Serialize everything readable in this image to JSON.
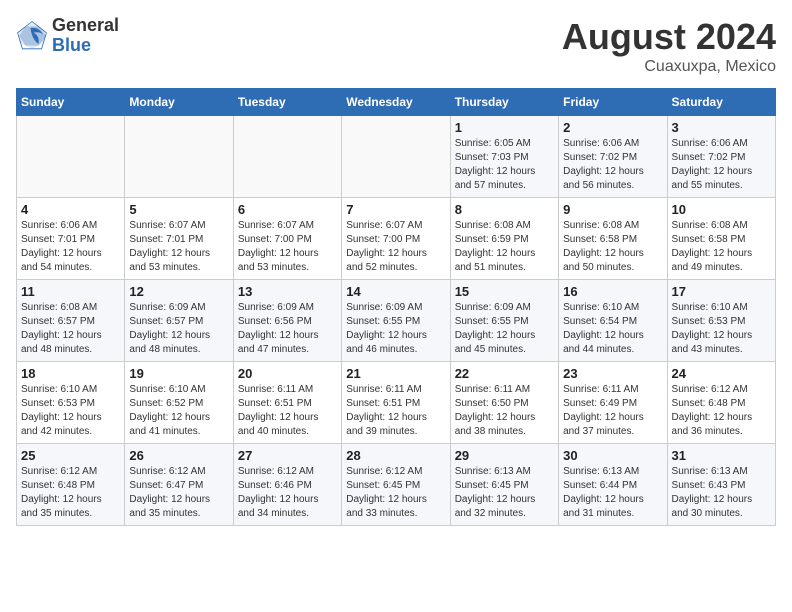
{
  "header": {
    "logo_line1": "General",
    "logo_line2": "Blue",
    "month_year": "August 2024",
    "location": "Cuaxuxpa, Mexico"
  },
  "days_of_week": [
    "Sunday",
    "Monday",
    "Tuesday",
    "Wednesday",
    "Thursday",
    "Friday",
    "Saturday"
  ],
  "weeks": [
    [
      {
        "day": "",
        "info": ""
      },
      {
        "day": "",
        "info": ""
      },
      {
        "day": "",
        "info": ""
      },
      {
        "day": "",
        "info": ""
      },
      {
        "day": "1",
        "info": "Sunrise: 6:05 AM\nSunset: 7:03 PM\nDaylight: 12 hours\nand 57 minutes."
      },
      {
        "day": "2",
        "info": "Sunrise: 6:06 AM\nSunset: 7:02 PM\nDaylight: 12 hours\nand 56 minutes."
      },
      {
        "day": "3",
        "info": "Sunrise: 6:06 AM\nSunset: 7:02 PM\nDaylight: 12 hours\nand 55 minutes."
      }
    ],
    [
      {
        "day": "4",
        "info": "Sunrise: 6:06 AM\nSunset: 7:01 PM\nDaylight: 12 hours\nand 54 minutes."
      },
      {
        "day": "5",
        "info": "Sunrise: 6:07 AM\nSunset: 7:01 PM\nDaylight: 12 hours\nand 53 minutes."
      },
      {
        "day": "6",
        "info": "Sunrise: 6:07 AM\nSunset: 7:00 PM\nDaylight: 12 hours\nand 53 minutes."
      },
      {
        "day": "7",
        "info": "Sunrise: 6:07 AM\nSunset: 7:00 PM\nDaylight: 12 hours\nand 52 minutes."
      },
      {
        "day": "8",
        "info": "Sunrise: 6:08 AM\nSunset: 6:59 PM\nDaylight: 12 hours\nand 51 minutes."
      },
      {
        "day": "9",
        "info": "Sunrise: 6:08 AM\nSunset: 6:58 PM\nDaylight: 12 hours\nand 50 minutes."
      },
      {
        "day": "10",
        "info": "Sunrise: 6:08 AM\nSunset: 6:58 PM\nDaylight: 12 hours\nand 49 minutes."
      }
    ],
    [
      {
        "day": "11",
        "info": "Sunrise: 6:08 AM\nSunset: 6:57 PM\nDaylight: 12 hours\nand 48 minutes."
      },
      {
        "day": "12",
        "info": "Sunrise: 6:09 AM\nSunset: 6:57 PM\nDaylight: 12 hours\nand 48 minutes."
      },
      {
        "day": "13",
        "info": "Sunrise: 6:09 AM\nSunset: 6:56 PM\nDaylight: 12 hours\nand 47 minutes."
      },
      {
        "day": "14",
        "info": "Sunrise: 6:09 AM\nSunset: 6:55 PM\nDaylight: 12 hours\nand 46 minutes."
      },
      {
        "day": "15",
        "info": "Sunrise: 6:09 AM\nSunset: 6:55 PM\nDaylight: 12 hours\nand 45 minutes."
      },
      {
        "day": "16",
        "info": "Sunrise: 6:10 AM\nSunset: 6:54 PM\nDaylight: 12 hours\nand 44 minutes."
      },
      {
        "day": "17",
        "info": "Sunrise: 6:10 AM\nSunset: 6:53 PM\nDaylight: 12 hours\nand 43 minutes."
      }
    ],
    [
      {
        "day": "18",
        "info": "Sunrise: 6:10 AM\nSunset: 6:53 PM\nDaylight: 12 hours\nand 42 minutes."
      },
      {
        "day": "19",
        "info": "Sunrise: 6:10 AM\nSunset: 6:52 PM\nDaylight: 12 hours\nand 41 minutes."
      },
      {
        "day": "20",
        "info": "Sunrise: 6:11 AM\nSunset: 6:51 PM\nDaylight: 12 hours\nand 40 minutes."
      },
      {
        "day": "21",
        "info": "Sunrise: 6:11 AM\nSunset: 6:51 PM\nDaylight: 12 hours\nand 39 minutes."
      },
      {
        "day": "22",
        "info": "Sunrise: 6:11 AM\nSunset: 6:50 PM\nDaylight: 12 hours\nand 38 minutes."
      },
      {
        "day": "23",
        "info": "Sunrise: 6:11 AM\nSunset: 6:49 PM\nDaylight: 12 hours\nand 37 minutes."
      },
      {
        "day": "24",
        "info": "Sunrise: 6:12 AM\nSunset: 6:48 PM\nDaylight: 12 hours\nand 36 minutes."
      }
    ],
    [
      {
        "day": "25",
        "info": "Sunrise: 6:12 AM\nSunset: 6:48 PM\nDaylight: 12 hours\nand 35 minutes."
      },
      {
        "day": "26",
        "info": "Sunrise: 6:12 AM\nSunset: 6:47 PM\nDaylight: 12 hours\nand 35 minutes."
      },
      {
        "day": "27",
        "info": "Sunrise: 6:12 AM\nSunset: 6:46 PM\nDaylight: 12 hours\nand 34 minutes."
      },
      {
        "day": "28",
        "info": "Sunrise: 6:12 AM\nSunset: 6:45 PM\nDaylight: 12 hours\nand 33 minutes."
      },
      {
        "day": "29",
        "info": "Sunrise: 6:13 AM\nSunset: 6:45 PM\nDaylight: 12 hours\nand 32 minutes."
      },
      {
        "day": "30",
        "info": "Sunrise: 6:13 AM\nSunset: 6:44 PM\nDaylight: 12 hours\nand 31 minutes."
      },
      {
        "day": "31",
        "info": "Sunrise: 6:13 AM\nSunset: 6:43 PM\nDaylight: 12 hours\nand 30 minutes."
      }
    ]
  ]
}
